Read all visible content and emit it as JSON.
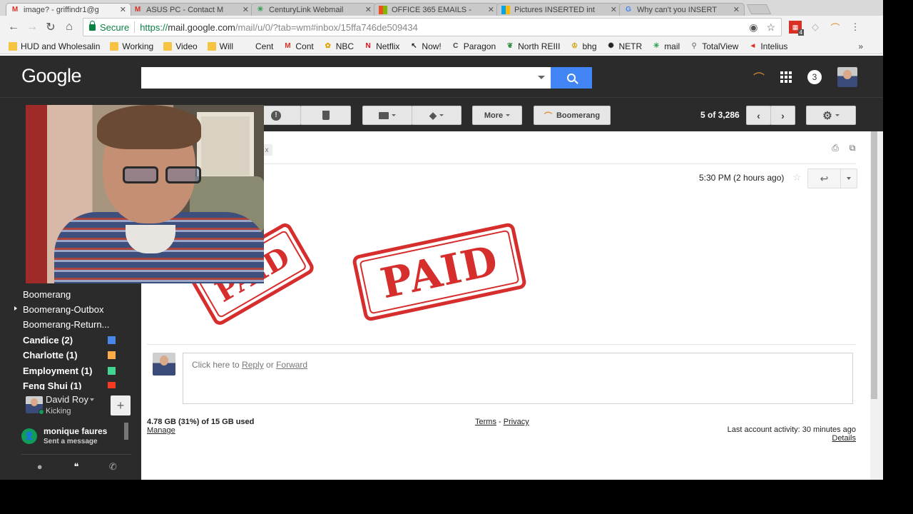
{
  "browser": {
    "tabs": [
      {
        "title": "image? - griffindr1@g",
        "icon": "gmail-icon",
        "active": true
      },
      {
        "title": "ASUS PC - Contact M",
        "icon": "gmail-icon",
        "active": false
      },
      {
        "title": "CenturyLink Webmail",
        "icon": "centurylink-icon",
        "active": false
      },
      {
        "title": "OFFICE 365 EMAILS - ",
        "icon": "office-icon",
        "active": false
      },
      {
        "title": "Pictures INSERTED int",
        "icon": "office-icon",
        "active": false
      },
      {
        "title": "Why can't you INSERT",
        "icon": "google-icon",
        "active": false
      }
    ],
    "secure_label": "Secure",
    "url_scheme": "https://",
    "url_host": "mail.google.com",
    "url_path": "/mail/u/0/?tab=wm#inbox/15ffa746de509434",
    "ext_badge": "4",
    "bookmarks": [
      {
        "label": "HUD and Wholesalin",
        "icon": "folder-icon"
      },
      {
        "label": "Working",
        "icon": "folder-icon"
      },
      {
        "label": "Video",
        "icon": "folder-icon"
      },
      {
        "label": "Will",
        "icon": "folder-icon"
      },
      {
        "label": "Cent",
        "icon": "blank-icon"
      },
      {
        "label": "Cont",
        "icon": "gmail-icon"
      },
      {
        "label": "NBC",
        "icon": "nbc-icon"
      },
      {
        "label": "Netflix",
        "icon": "netflix-icon"
      },
      {
        "label": "Now!",
        "icon": "cursor-icon"
      },
      {
        "label": "Paragon",
        "icon": "paragon-icon"
      },
      {
        "label": "North REIII",
        "icon": "leaf-icon"
      },
      {
        "label": "bhg",
        "icon": "bhg-icon"
      },
      {
        "label": "NETR",
        "icon": "netr-icon"
      },
      {
        "label": "mail",
        "icon": "centurylink-icon"
      },
      {
        "label": "TotalView",
        "icon": "search-icon"
      },
      {
        "label": "Intelius",
        "icon": "intelius-icon"
      }
    ],
    "bookmarks_more": "»"
  },
  "gmail": {
    "logo": "Google",
    "search_placeholder": "",
    "notification_count": "3",
    "actions": {
      "more_label": "More",
      "boomerang_label": "Boomerang",
      "count_label": "5 of 3,286"
    },
    "nav_labels": [
      {
        "label": "Boomerang",
        "bold": false,
        "color": null
      },
      {
        "label": "Boomerang-Outbox",
        "bold": false,
        "color": null,
        "expandable": true
      },
      {
        "label": "Boomerang-Return...",
        "bold": false,
        "color": null
      },
      {
        "label": "Candice (2)",
        "bold": true,
        "color": "#4986e7"
      },
      {
        "label": "Charlotte (1)",
        "bold": true,
        "color": "#ffad46"
      },
      {
        "label": "Employment (1)",
        "bold": true,
        "color": "#42d692"
      },
      {
        "label": "Feng Shui (1)",
        "bold": true,
        "color": "#f83a22"
      }
    ],
    "chat": {
      "me_name": "David Roy",
      "me_status": "Kicking",
      "contact_name": "monique faures",
      "contact_status": "Sent a message"
    },
    "message": {
      "timestamp": "5:30 PM (2 hours ago)",
      "stamp_text": "PAID",
      "reply_prefix": "Click here to ",
      "reply_link": "Reply",
      "reply_or": " or ",
      "forward_link": "Forward"
    },
    "footer": {
      "storage": "4.78 GB (31%) of 15 GB used",
      "manage": "Manage",
      "terms": "Terms",
      "dash": " - ",
      "privacy": "Privacy",
      "activity": "Last account activity: 30 minutes ago",
      "details": "Details"
    }
  },
  "colors": {
    "stamp_red": "#d62d2d",
    "gmail_dark": "#2b2b2b",
    "search_blue": "#4285f4"
  }
}
